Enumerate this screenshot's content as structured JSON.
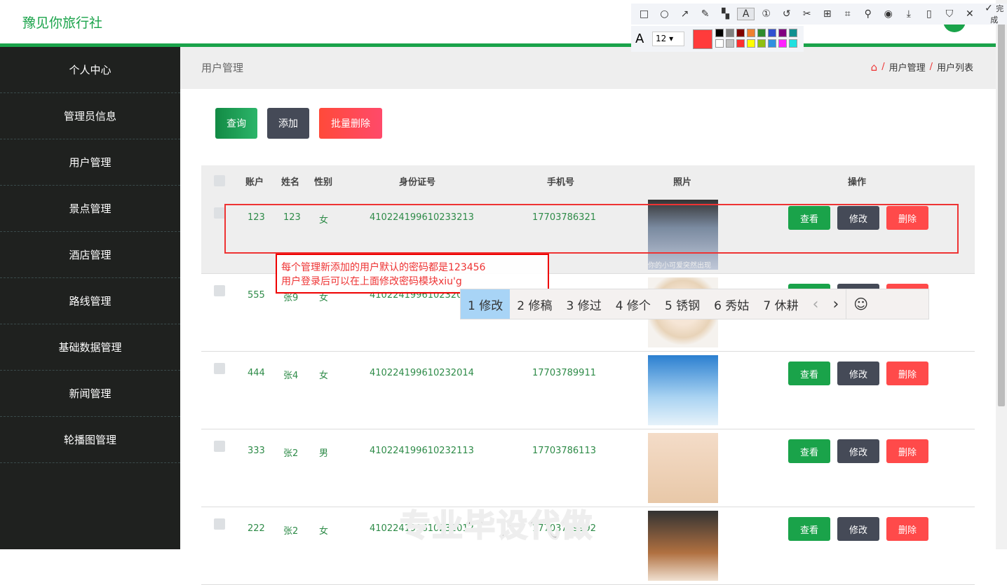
{
  "header": {
    "logo": "豫见你旅行社"
  },
  "sidebar": {
    "items": [
      {
        "label": "个人中心"
      },
      {
        "label": "管理员信息"
      },
      {
        "label": "用户管理"
      },
      {
        "label": "景点管理"
      },
      {
        "label": "酒店管理"
      },
      {
        "label": "路线管理"
      },
      {
        "label": "基础数据管理"
      },
      {
        "label": "新闻管理"
      },
      {
        "label": "轮播图管理"
      }
    ]
  },
  "page": {
    "title": "用户管理",
    "breadcrumb": [
      "用户管理",
      "用户列表"
    ],
    "sep": "/"
  },
  "toolbar": {
    "query": "查询",
    "add": "添加",
    "batch_delete": "批量删除"
  },
  "table": {
    "headers": [
      "账户",
      "姓名",
      "性别",
      "身份证号",
      "手机号",
      "照片",
      "操作"
    ],
    "rows": [
      {
        "account": "123",
        "name": "123",
        "gender": "女",
        "id": "410224199610233213",
        "phone": "17703786321"
      },
      {
        "account": "555",
        "name": "张9",
        "gender": "女",
        "id": "41022419961023208",
        "phone": ""
      },
      {
        "account": "444",
        "name": "张4",
        "gender": "女",
        "id": "410224199610232014",
        "phone": "17703789911"
      },
      {
        "account": "333",
        "name": "张2",
        "gender": "男",
        "id": "410224199610232113",
        "phone": "17703786113"
      },
      {
        "account": "222",
        "name": "张2",
        "gender": "女",
        "id": "410224199610232012",
        "phone": "17703799992"
      }
    ],
    "actions": {
      "view": "查看",
      "edit": "修改",
      "delete": "删除"
    },
    "photo_caption": "你的小可爱突然出现"
  },
  "annotation": {
    "line1": "每个管理新添加的用户默认的密码都是123456",
    "line2": "用户登录后可以在上面修改密码模块xiu'g"
  },
  "ime": {
    "candidates": [
      "1 修改",
      "2 修稿",
      "3 修过",
      "4 修个",
      "5 锈钢",
      "6 秀姑",
      "7 休耕"
    ],
    "prev": "‹",
    "next": "›",
    "emoji": "☺"
  },
  "screenshot_tool": {
    "font_size": "12",
    "done": "完成",
    "current_color": "#ff3b3b"
  },
  "watermark": "专业毕设代做",
  "colors": {
    "brand": "#1aa34a",
    "view": "#1aa34a",
    "edit": "#454a57",
    "delete": "#ff4a4a"
  }
}
